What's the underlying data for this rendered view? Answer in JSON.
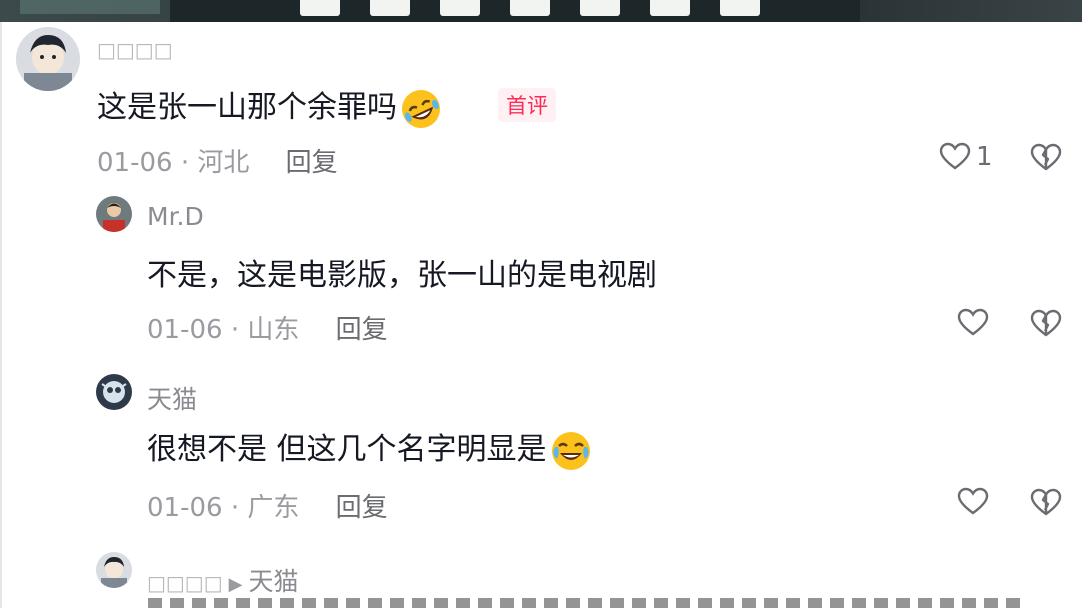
{
  "comments": [
    {
      "username": "□□□□",
      "text": "这是张一山那个余罪吗",
      "emoji": "rofl-emoji",
      "badge": "首评",
      "date": "01-06",
      "region": "河北",
      "reply": "回复",
      "likes": "1"
    },
    {
      "username": "Mr.D",
      "text": "不是，这是电影版，张一山的是电视剧",
      "date": "01-06",
      "region": "山东",
      "reply": "回复"
    },
    {
      "username": "天猫",
      "text": "很想不是 但这几个名字明显是",
      "emoji": "crying-laughing-emoji",
      "date": "01-06",
      "region": "广东",
      "reply": "回复"
    },
    {
      "username": "□□□□",
      "reply_to": "天猫"
    }
  ],
  "separator": "·",
  "colors": {
    "accent": "#fe2c55",
    "text": "#161823",
    "muted": "#9a9ba1"
  }
}
